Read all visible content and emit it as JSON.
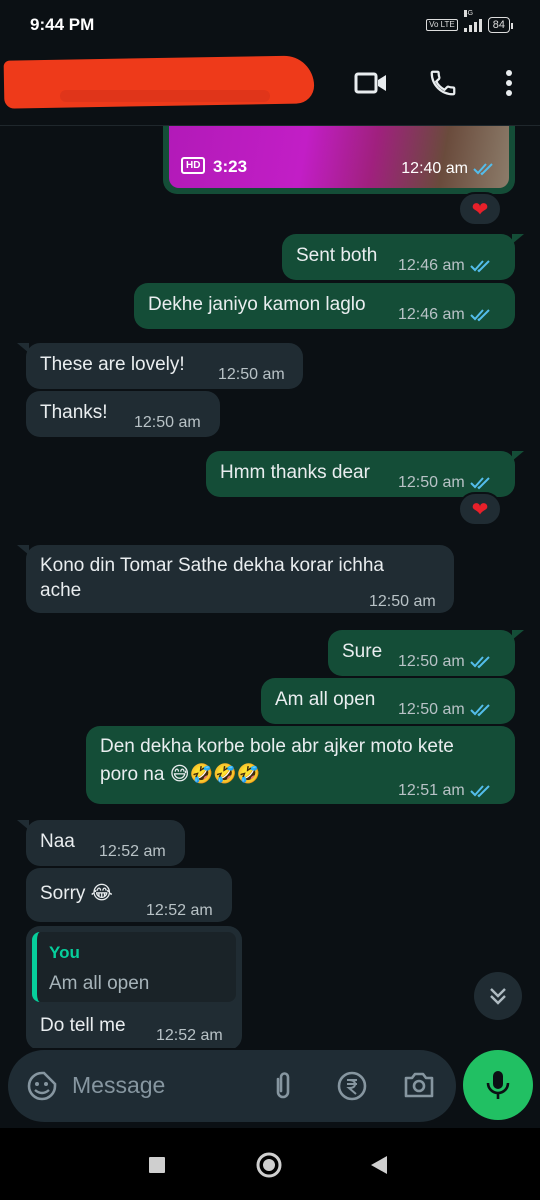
{
  "status_bar": {
    "time": "9:44 PM",
    "network": "4G",
    "volte": "Vo LTE",
    "battery": "84"
  },
  "header": {
    "contact_name_redacted": true
  },
  "video_message": {
    "hd_label": "HD",
    "duration": "3:23",
    "time": "12:40 am",
    "reaction": "❤"
  },
  "messages": [
    {
      "dir": "out",
      "text": "Sent both",
      "time": "12:46 am"
    },
    {
      "dir": "out",
      "text": "Dekhe janiyo kamon laglo",
      "time": "12:46 am"
    },
    {
      "dir": "in",
      "text": "These are lovely!",
      "time": "12:50 am"
    },
    {
      "dir": "in",
      "text": "Thanks!",
      "time": "12:50 am"
    },
    {
      "dir": "out",
      "text": "Hmm thanks dear",
      "time": "12:50 am",
      "reaction": "❤"
    },
    {
      "dir": "in",
      "text_line1": "Kono din Tomar Sathe dekha korar ichha",
      "text_line2": "ache",
      "time": "12:50 am"
    },
    {
      "dir": "out",
      "text": "Sure",
      "time": "12:50 am"
    },
    {
      "dir": "out",
      "text": "Am all open",
      "time": "12:50 am"
    },
    {
      "dir": "out",
      "text_line1": "Den dekha korbe bole abr ajker moto kete",
      "text_line2": "poro na 😅🤣🤣🤣",
      "time": "12:51 am"
    },
    {
      "dir": "in",
      "text": "Naa",
      "time": "12:52 am"
    },
    {
      "dir": "in",
      "text": "Sorry 😂",
      "time": "12:52 am"
    },
    {
      "dir": "in",
      "quote_author": "You",
      "quote_text": "Am all open",
      "text": "Do tell me",
      "time": "12:52 am"
    }
  ],
  "input": {
    "placeholder": "Message"
  },
  "colors": {
    "outgoing": "#144d37",
    "incoming": "#202c33",
    "accent": "#21c063",
    "tick": "#53bdeb",
    "background": "#0b1014"
  }
}
